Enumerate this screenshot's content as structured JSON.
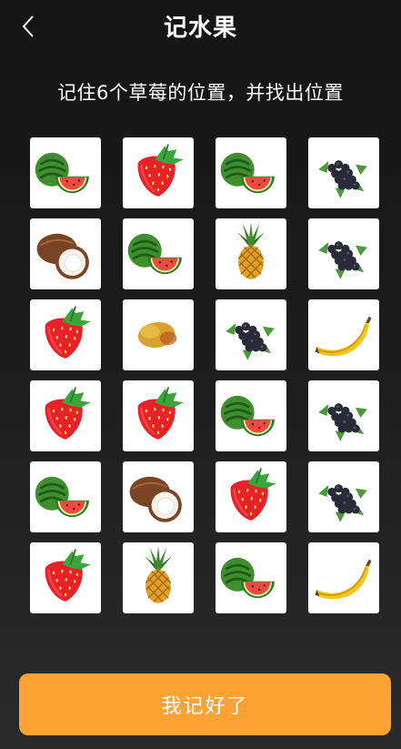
{
  "header": {
    "title": "记水果",
    "back_icon": "chevron-left-icon"
  },
  "instruction": "记住6个草莓的位置，并找出位置",
  "grid": {
    "columns": 4,
    "rows": 6,
    "cells": [
      "watermelon",
      "strawberry",
      "watermelon",
      "blackberry",
      "coconut",
      "watermelon",
      "pineapple",
      "blackberry",
      "strawberry",
      "mango",
      "blackberry",
      "banana",
      "strawberry",
      "strawberry",
      "watermelon",
      "blackberry",
      "watermelon",
      "coconut",
      "strawberry",
      "blackberry",
      "strawberry",
      "pineapple",
      "watermelon",
      "banana"
    ]
  },
  "confirm_button": {
    "label": "我记好了",
    "color": "#ffa234"
  }
}
